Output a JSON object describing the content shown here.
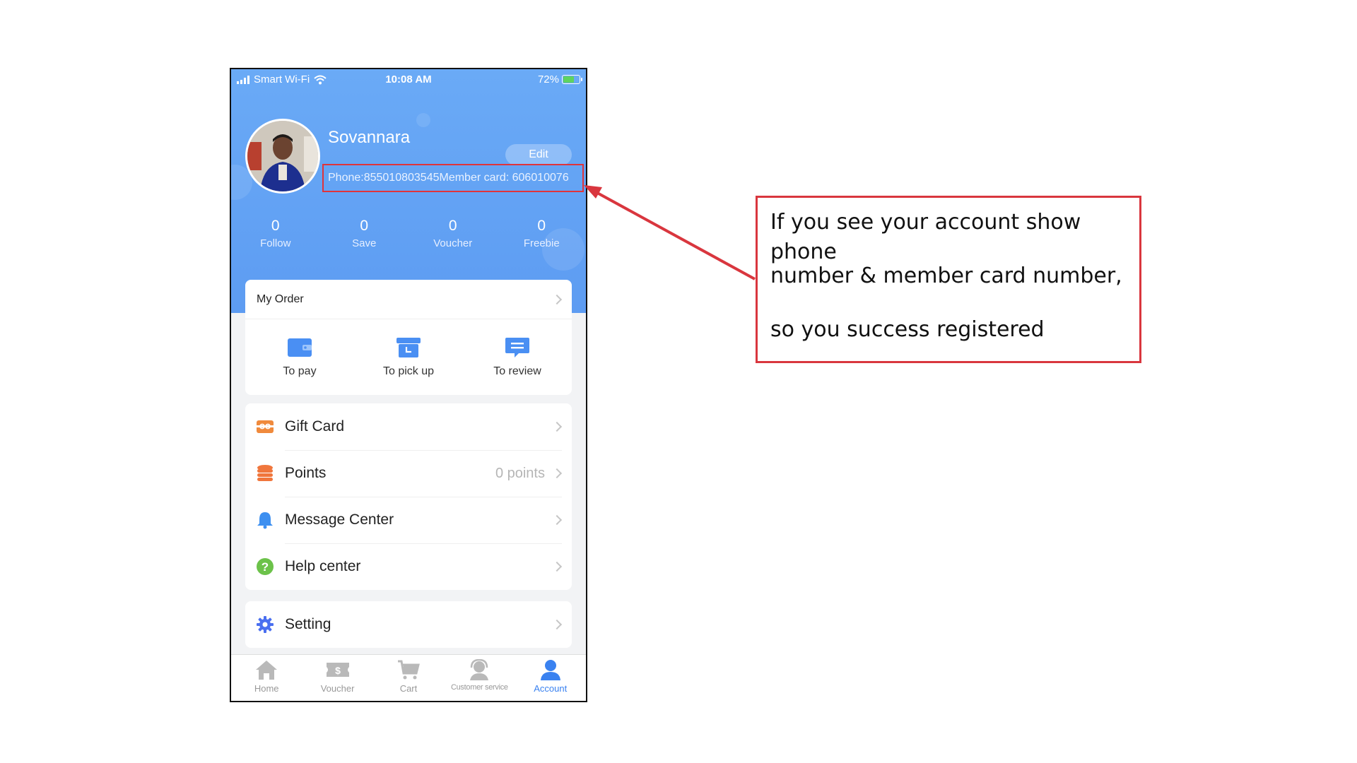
{
  "status_bar": {
    "carrier": "Smart Wi-Fi",
    "time": "10:08 AM",
    "battery": "72%",
    "battery_level": 0.72
  },
  "profile": {
    "name": "Sovannara",
    "edit_label": "Edit",
    "id_line": "Phone:855010803545Member card: 606010076"
  },
  "stats": [
    {
      "value": "0",
      "label": "Follow"
    },
    {
      "value": "0",
      "label": "Save"
    },
    {
      "value": "0",
      "label": "Voucher"
    },
    {
      "value": "0",
      "label": "Freebie"
    }
  ],
  "order": {
    "title": "My Order",
    "items": [
      {
        "label": "To pay",
        "icon": "wallet-icon"
      },
      {
        "label": "To pick up",
        "icon": "box-icon"
      },
      {
        "label": "To review",
        "icon": "comment-icon"
      }
    ]
  },
  "menu": [
    {
      "label": "Gift Card",
      "icon": "gift-card-icon",
      "value": ""
    },
    {
      "label": "Points",
      "icon": "coins-icon",
      "value": "0 points"
    },
    {
      "label": "Message Center",
      "icon": "bell-icon",
      "value": ""
    },
    {
      "label": "Help center",
      "icon": "help-icon",
      "value": ""
    }
  ],
  "setting": {
    "label": "Setting",
    "icon": "gear-icon"
  },
  "tabs": [
    {
      "label": "Home",
      "icon": "home-icon"
    },
    {
      "label": "Voucher",
      "icon": "voucher-icon"
    },
    {
      "label": "Cart",
      "icon": "cart-icon"
    },
    {
      "label": "Customer service",
      "icon": "headset-icon"
    },
    {
      "label": "Account",
      "icon": "person-icon",
      "active": true
    }
  ],
  "annotation": {
    "lines": [
      "If you see your account show phone",
      "number & member card number,",
      "so you success registered"
    ]
  },
  "colors": {
    "header_blue": "#6aaaf6",
    "accent": "#3a82f0",
    "highlight_red": "#d9363e"
  }
}
